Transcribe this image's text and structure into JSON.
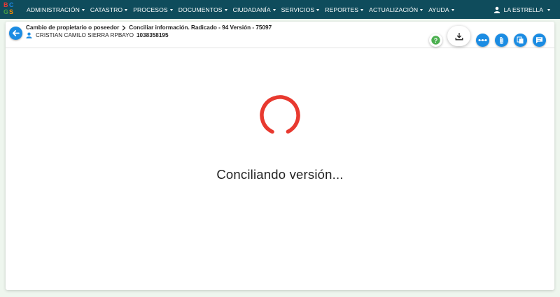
{
  "brand": {
    "letters": [
      "B",
      "C",
      "G",
      "S"
    ],
    "colors": [
      "#e53935",
      "#1e88e5",
      "#43a047",
      "#fb8c00"
    ]
  },
  "nav": {
    "items": [
      {
        "label": "ADMINISTRACIÓN"
      },
      {
        "label": "CATASTRO"
      },
      {
        "label": "PROCESOS"
      },
      {
        "label": "DOCUMENTOS"
      },
      {
        "label": "CIUDADANÍA"
      },
      {
        "label": "SERVICIOS"
      },
      {
        "label": "REPORTES"
      },
      {
        "label": "ACTUALIZACIÓN"
      },
      {
        "label": "AYUDA"
      }
    ],
    "user_label": "LA ESTRELLA"
  },
  "header": {
    "breadcrumb_parent": "Cambio de propietario o poseedor",
    "breadcrumb_current": "Conciliar información. Radicado - 94 Versión - 75097",
    "user_name": "CRISTIAN CAMILO SIERRA RPBAYO",
    "user_document": "1038358195"
  },
  "actions": [
    {
      "name": "help-icon"
    },
    {
      "name": "download-icon"
    },
    {
      "name": "more-dots-icon"
    },
    {
      "name": "attachment-icon"
    },
    {
      "name": "copy-documents-icon"
    },
    {
      "name": "comment-icon"
    }
  ],
  "status": {
    "loading_text": "Conciliando versión..."
  },
  "colors": {
    "topbar": "#0f4c5c",
    "accent_blue": "#1b8ce3",
    "spinner": "#e8392f",
    "help_green": "#4caf50"
  }
}
